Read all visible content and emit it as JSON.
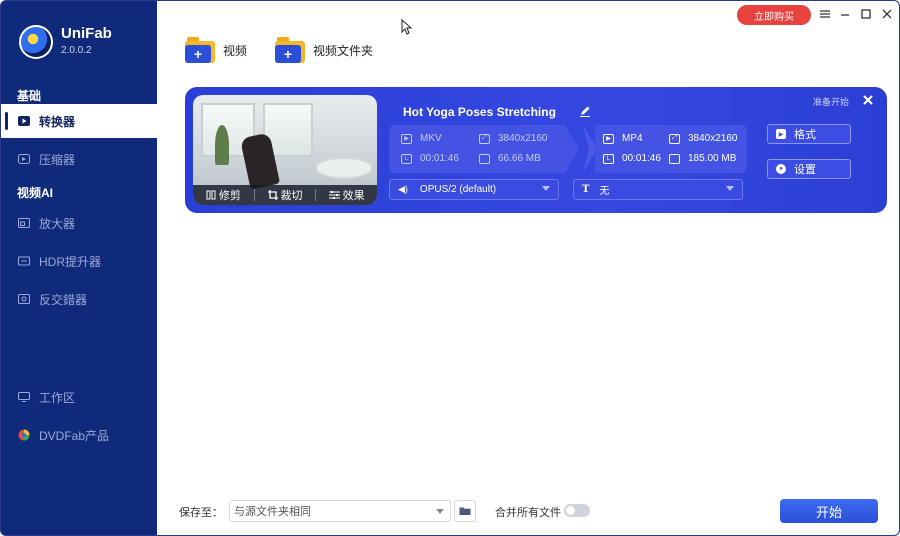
{
  "app": {
    "brand": "UniFab",
    "version": "2.0.0.2"
  },
  "topbar": {
    "buy_label": "立即购买",
    "controls": [
      "menu",
      "minimize",
      "maximize",
      "close"
    ]
  },
  "sidebar": {
    "sections": [
      {
        "title": "基础",
        "items": [
          {
            "label": "转换器",
            "icon": "play-icon",
            "active": true
          },
          {
            "label": "压缩器",
            "icon": "compress-icon",
            "active": false
          }
        ]
      },
      {
        "title": "视频AI",
        "items": [
          {
            "label": "放大器",
            "icon": "upscale-icon",
            "active": false
          },
          {
            "label": "HDR提升器",
            "icon": "hdr-icon",
            "active": false
          },
          {
            "label": "反交錯器",
            "icon": "deinterlace-icon",
            "active": false
          }
        ]
      }
    ],
    "bottom_items": [
      {
        "label": "工作区",
        "icon": "monitor-icon"
      },
      {
        "label": "DVDFab产品",
        "icon": "dvdfab-icon"
      }
    ]
  },
  "toolbar": {
    "add_video_label": "视频",
    "add_folder_label": "视频文件夹"
  },
  "task": {
    "title": "Hot Yoga Poses Stretching",
    "status": "准备开始",
    "thumb_actions": [
      "修剪",
      "裁切",
      "效果"
    ],
    "source": {
      "format": "MKV",
      "resolution": "3840x2160",
      "duration": "00:01:46",
      "size": "66.66 MB"
    },
    "output": {
      "format": "MP4",
      "resolution": "3840x2160",
      "duration": "00:01:46",
      "size": "185.00 MB"
    },
    "audio_track": "OPUS/2 (default)",
    "subtitle": "无",
    "format_button": "格式",
    "settings_button": "设置"
  },
  "bottom": {
    "save_label": "保存至：",
    "save_value": "与源文件夹相同",
    "merge_label": "合并所有文件",
    "merge_enabled": false,
    "start_label": "开始"
  },
  "colors": {
    "sidebar": "#0f2a7a",
    "card": "#3547e0",
    "buy": "#e8413e",
    "start": "#2a4fd6"
  }
}
